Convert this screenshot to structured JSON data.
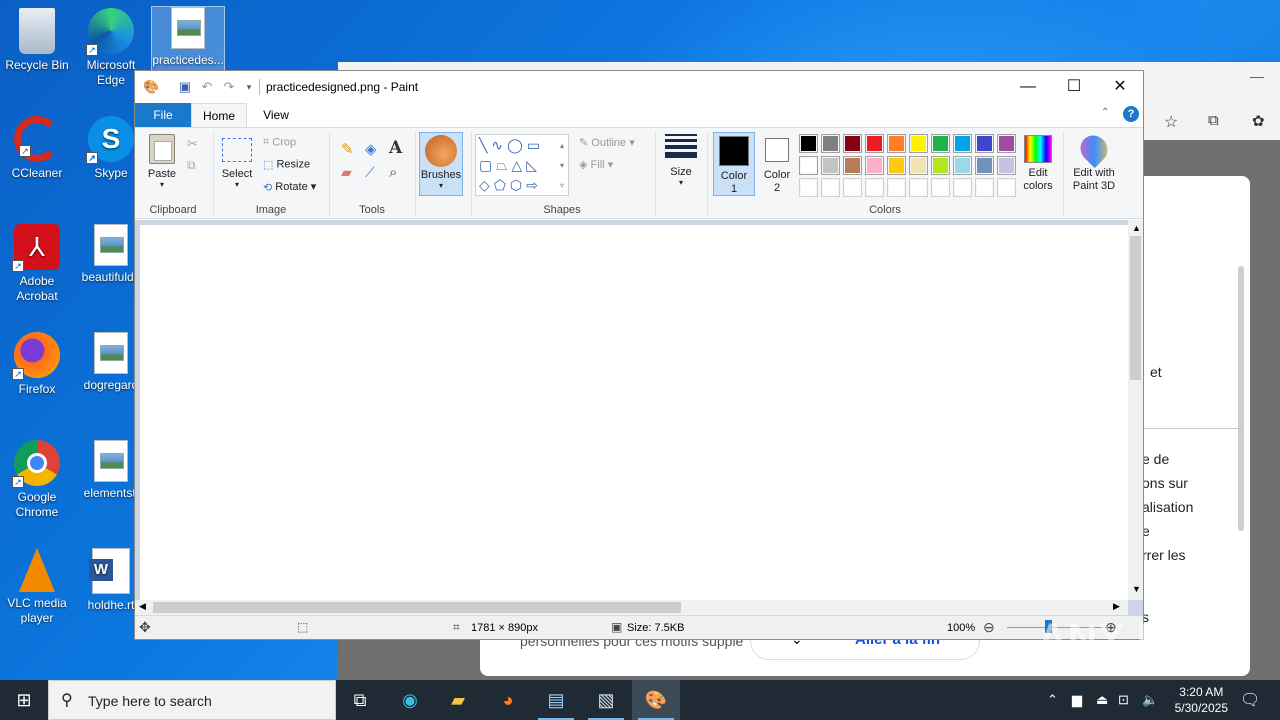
{
  "desktop": {
    "icons": [
      {
        "label": "Recycle Bin",
        "icon": "recycle-bin-icon"
      },
      {
        "label": "Microsoft Edge",
        "icon": "edge-icon"
      },
      {
        "label": "practicedes...",
        "icon": "image-file-icon"
      },
      {
        "label": "CCleaner",
        "icon": "ccleaner-icon"
      },
      {
        "label": "Skype",
        "icon": "skype-icon"
      },
      {
        "label": "Adobe Acrobat",
        "icon": "acrobat-icon"
      },
      {
        "label": "beautifulde",
        "icon": "image-file-icon"
      },
      {
        "label": "Firefox",
        "icon": "firefox-icon"
      },
      {
        "label": "dogregard",
        "icon": "image-file-icon"
      },
      {
        "label": "Google Chrome",
        "icon": "chrome-icon"
      },
      {
        "label": "elementsti",
        "icon": "image-file-icon"
      },
      {
        "label": "VLC media player",
        "icon": "vlc-icon"
      },
      {
        "label": "holdhe.rt",
        "icon": "word-file-icon"
      }
    ]
  },
  "browser_bg": {
    "texts": [
      "et",
      "e de",
      "ons sur",
      "alisation",
      "e",
      "rrer les",
      "s",
      "personnelles pour ces motifs supplé"
    ],
    "button": "Aller à la fin"
  },
  "paint": {
    "title": "practicedesigned.png - Paint",
    "tabs": {
      "file": "File",
      "home": "Home",
      "view": "View"
    },
    "clipboard": {
      "paste": "Paste",
      "label": "Clipboard"
    },
    "image": {
      "select": "Select",
      "crop": "Crop",
      "resize": "Resize",
      "rotate": "Rotate",
      "label": "Image"
    },
    "tools": {
      "label": "Tools"
    },
    "brushes": {
      "label": "Brushes"
    },
    "shapes": {
      "outline": "Outline",
      "fill": "Fill",
      "label": "Shapes"
    },
    "size": {
      "label": "Size"
    },
    "colors": {
      "color1": "Color 1",
      "color2": "Color 2",
      "edit": "Edit colors",
      "paint3d": "Edit with Paint 3D",
      "label": "Colors",
      "color1_value": "#000000",
      "color2_value": "#ffffff",
      "palette_row1": [
        "#000000",
        "#7f7f7f",
        "#880015",
        "#ed1c24",
        "#ff7f27",
        "#fff200",
        "#22b14c",
        "#00a2e8",
        "#3f48cc",
        "#a349a4"
      ],
      "palette_row2": [
        "#ffffff",
        "#c3c3c3",
        "#b97a57",
        "#ffaec9",
        "#ffc90e",
        "#efe4b0",
        "#b5e61d",
        "#99d9ea",
        "#7092be",
        "#c8bfe7"
      ],
      "palette_row3": [
        "#ffffff",
        "#ffffff",
        "#ffffff",
        "#ffffff",
        "#ffffff",
        "#ffffff",
        "#ffffff",
        "#ffffff",
        "#ffffff",
        "#ffffff"
      ]
    },
    "status": {
      "dimensions": "1781 × 890px",
      "size": "Size: 7.5KB",
      "zoom": "100%"
    }
  },
  "taskbar": {
    "search_placeholder": "Type here to search",
    "time": "3:20 AM",
    "date": "5/30/2025"
  },
  "watermark": "ANY RUN"
}
